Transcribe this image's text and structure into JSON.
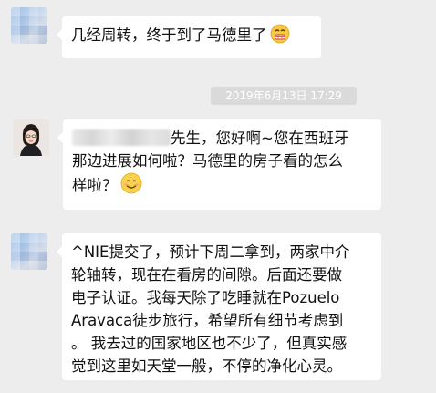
{
  "messages": [
    {
      "sender": "contact-blurred",
      "text": "几经周转，终于到了马德里了",
      "emoji": "sweat-grin-emoji"
    },
    {
      "sender": "agent-woman",
      "line1_suffix": "先生，您好啊~您在西班牙",
      "line2": "那边进展如何啦？马德里的房子看的怎么",
      "line3": "样啦？",
      "emoji": "smile-emoji"
    },
    {
      "sender": "contact-blurred",
      "lines": [
        "^NIE提交了，预计下周二拿到，两家中介",
        "轮轴转，现在在看房的间隙。后面还要做",
        "电子认证。我每天除了吃睡就在Pozuelo",
        "Aravaca徒步旅行，希望所有细节考虑到",
        "。 我去过的国家地区也不少了，但真实感",
        "觉到这里如天堂一般，不停的净化心灵。"
      ]
    }
  ],
  "timestamp": "2019年6月13日 17:29",
  "colors": {
    "background": "#ededed",
    "bubble": "#ffffff",
    "timestamp_bg": "#dadada"
  }
}
